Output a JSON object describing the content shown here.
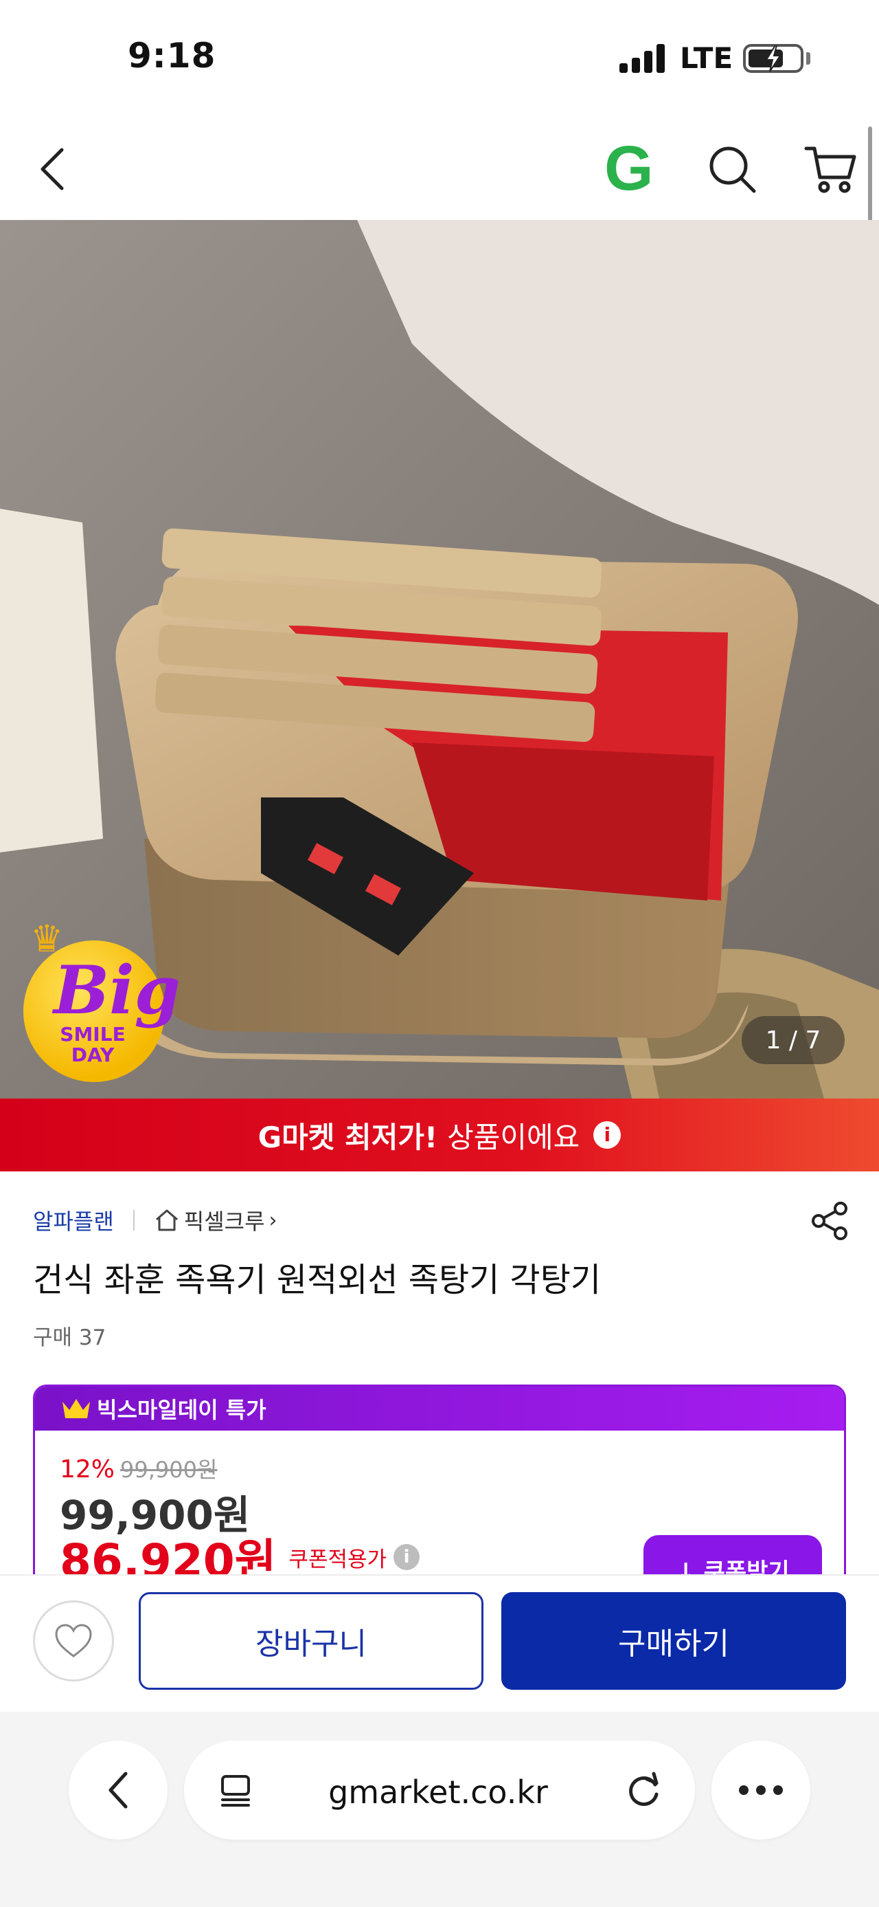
{
  "status_bar": {
    "time": "9:18",
    "network": "LTE"
  },
  "top_nav": {
    "logo": "G"
  },
  "hero": {
    "counter": "1 / 7",
    "badge_big": "Big",
    "badge_line1": "SMILE",
    "badge_line2": "DAY"
  },
  "price_banner": {
    "bold": "G마켓 최저가!",
    "text": "상품이에요",
    "info": "i"
  },
  "product": {
    "brand": "알파플랜",
    "shop": "픽셀크루",
    "shop_chevron": "›",
    "title": "건식 좌훈 족욕기 원적외선 족탕기 각탕기",
    "purchase_count": "구매 37"
  },
  "deal": {
    "header": "빅스마일데이 특가",
    "discount_rate": "12%",
    "original_price": "99,900원",
    "price": "99,900원",
    "coupon_price": "86,920원",
    "coupon_label": "쿠폰적용가",
    "coupon_info": "i",
    "coupon_button": "↓ 쿠폰받기"
  },
  "actions": {
    "cart": "장바구니",
    "buy": "구매하기"
  },
  "browser": {
    "url": "gmarket.co.kr"
  },
  "colors": {
    "brand_blue": "#0b2aa8",
    "deal_purple": "#8a17d8",
    "sale_red": "#e2001a",
    "banner_red": "#d4001a",
    "logo_green": "#2bb24c"
  }
}
